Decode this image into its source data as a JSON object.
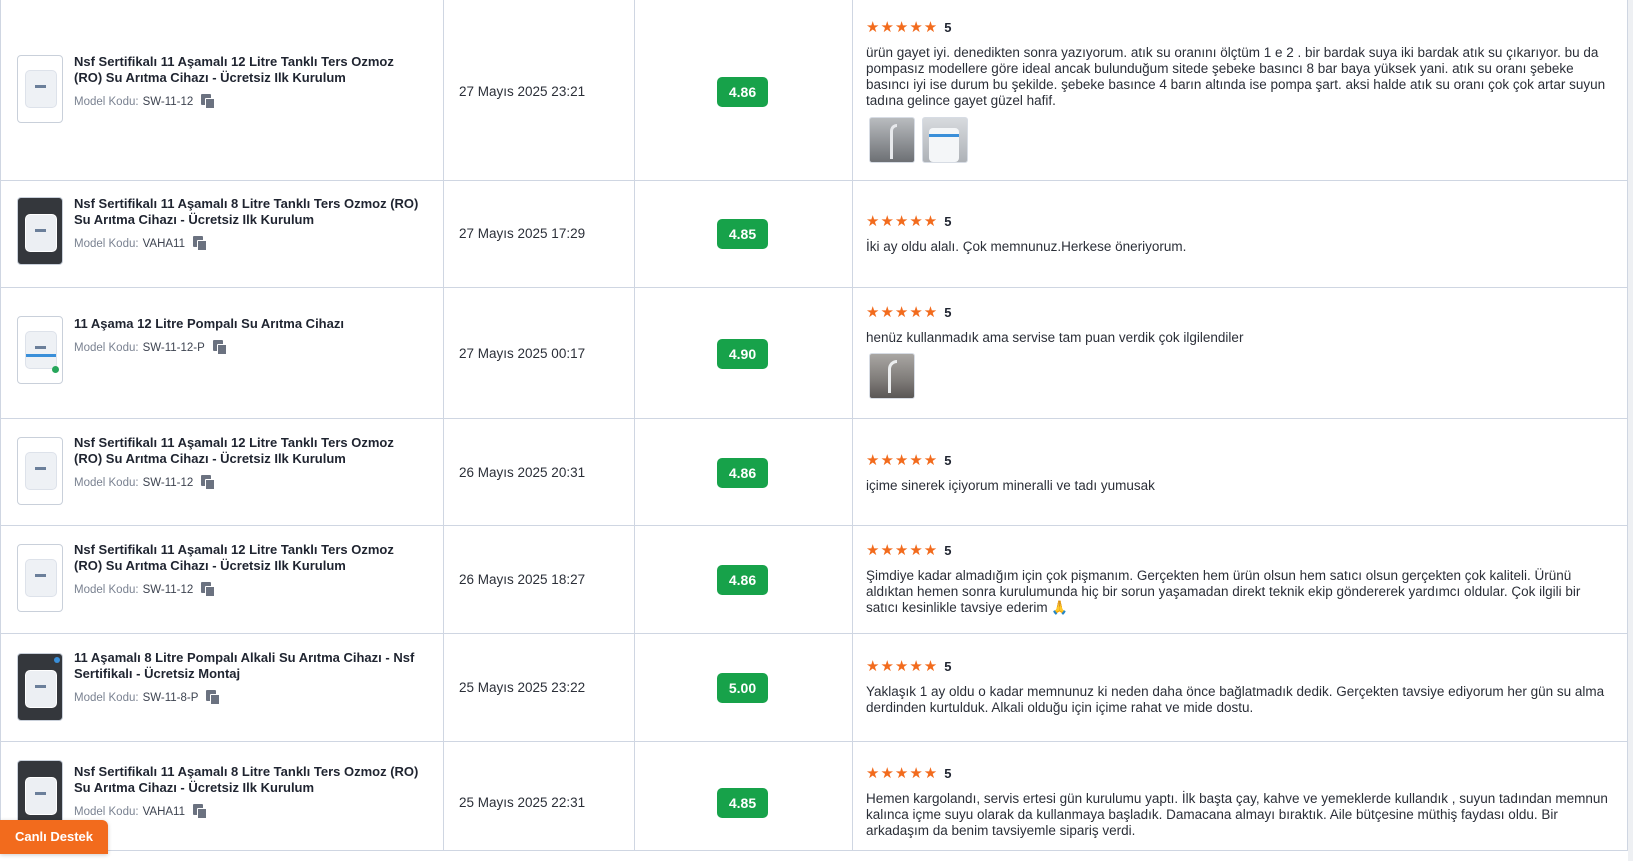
{
  "rows": [
    {
      "product": {
        "name": "Nsf Sertifikalı 11 Aşamalı 12 Litre Tanklı Ters Ozmoz (RO) Su Arıtma Cihazı - Ücretsiz Ilk Kurulum",
        "model_label": "Model Kodu:",
        "model_code": "SW-11-12",
        "thumb": "white-unit-icon"
      },
      "date": "27 Mayıs 2025 23:21",
      "score": "4.86",
      "rating": {
        "stars": "★★★★★",
        "value": "5"
      },
      "review": "ürün gayet iyi. denedikten sonra yazıyorum. atık su oranını ölçtüm 1 e 2 . bir bardak suya iki bardak atık su çıkarıyor. bu da pompasız modellere göre ideal ancak bulunduğum sitede şebeke basıncı 8 bar baya yüksek yani. atık su oranı şebeke basıncı iyi ise durum bu şekilde. şebeke basınce 4 barın altında ise pompa şart. aksi halde atık su oranı çok çok artar suyun tadına gelince gayet güzel hafif."
    },
    {
      "product": {
        "name": "Nsf Sertifikalı 11 Aşamalı 8 Litre Tanklı Ters Ozmoz (RO) Su Arıtma Cihazı - Ücretsiz Ilk Kurulum",
        "model_label": "Model Kodu:",
        "model_code": "VAHA11",
        "thumb": "dark-unit-icon"
      },
      "date": "27 Mayıs 2025 17:29",
      "score": "4.85",
      "rating": {
        "stars": "★★★★★",
        "value": "5"
      },
      "review": "İki ay oldu alalı. Çok memnunuz.Herkese öneriyorum."
    },
    {
      "product": {
        "name": "11 Aşama 12 Litre Pompalı Su Arıtma Cihazı",
        "model_label": "Model Kodu:",
        "model_code": "SW-11-12-P",
        "thumb": "white-unit-blue-stripe-icon"
      },
      "date": "27 Mayıs 2025 00:17",
      "score": "4.90",
      "rating": {
        "stars": "★★★★★",
        "value": "5"
      },
      "review": "henüz kullanmadık ama servise tam puan verdik çok ilgilendiler"
    },
    {
      "product": {
        "name": "Nsf Sertifikalı 11 Aşamalı 12 Litre Tanklı Ters Ozmoz (RO) Su Arıtma Cihazı - Ücretsiz Ilk Kurulum",
        "model_label": "Model Kodu:",
        "model_code": "SW-11-12",
        "thumb": "white-unit-icon"
      },
      "date": "26 Mayıs 2025 20:31",
      "score": "4.86",
      "rating": {
        "stars": "★★★★★",
        "value": "5"
      },
      "review": "içime sinerek içiyorum mineralli ve tadı yumusak"
    },
    {
      "product": {
        "name": "Nsf Sertifikalı 11 Aşamalı 12 Litre Tanklı Ters Ozmoz (RO) Su Arıtma Cihazı - Ücretsiz Ilk Kurulum",
        "model_label": "Model Kodu:",
        "model_code": "SW-11-12",
        "thumb": "white-unit-icon"
      },
      "date": "26 Mayıs 2025 18:27",
      "score": "4.86",
      "rating": {
        "stars": "★★★★★",
        "value": "5"
      },
      "review": "Şimdiye kadar almadığım için çok pişmanım. Gerçekten hem ürün olsun hem satıcı olsun gerçekten çok kaliteli. Ürünü aldıktan hemen sonra kurulumunda hiç bir sorun yaşamadan direkt teknik ekip göndererek yardımcı oldular. Çok ilgili bir satıcı kesinlikle tavsiye ederim 🙏"
    },
    {
      "product": {
        "name": "11 Aşamalı 8 Litre Pompalı Alkali Su Arıtma Cihazı - Nsf Sertifikalı - Ücretsiz Montaj",
        "model_label": "Model Kodu:",
        "model_code": "SW-11-8-P",
        "thumb": "dark-unit-icon"
      },
      "date": "25 Mayıs 2025 23:22",
      "score": "5.00",
      "rating": {
        "stars": "★★★★★",
        "value": "5"
      },
      "review": "Yaklaşık 1 ay oldu o kadar memnunuz ki neden daha önce bağlatmadık dedik. Gerçekten tavsiye ediyorum her gün su alma derdinden kurtulduk. Alkali olduğu için içime rahat ve mide dostu."
    },
    {
      "product": {
        "name": "Nsf Sertifikalı 11 Aşamalı 8 Litre Tanklı Ters Ozmoz (RO) Su Arıtma Cihazı - Ücretsiz Ilk Kurulum",
        "model_label": "Model Kodu:",
        "model_code": "VAHA11",
        "thumb": "dark-unit-icon"
      },
      "date": "25 Mayıs 2025 22:31",
      "score": "4.85",
      "rating": {
        "stars": "★★★★★",
        "value": "5"
      },
      "review": "Hemen kargolandı, servis ertesi gün kurulumu yaptı. İlk başta çay, kahve ve yemeklerde kullandık , suyun tadından memnun kalınca içme suyu olarak da kullanmaya başladık. Damacana almayı bıraktık. Aile bütçesine müthiş faydası oldu. Bir arkadaşım da benim tavsiyemle sipariş verdi."
    }
  ],
  "support": {
    "label": "Canlı Destek"
  },
  "colors": {
    "score_green": "#17a24a",
    "star_orange": "#f26b1d",
    "border": "#cfd6e2",
    "support_orange": "#f26b1d"
  }
}
